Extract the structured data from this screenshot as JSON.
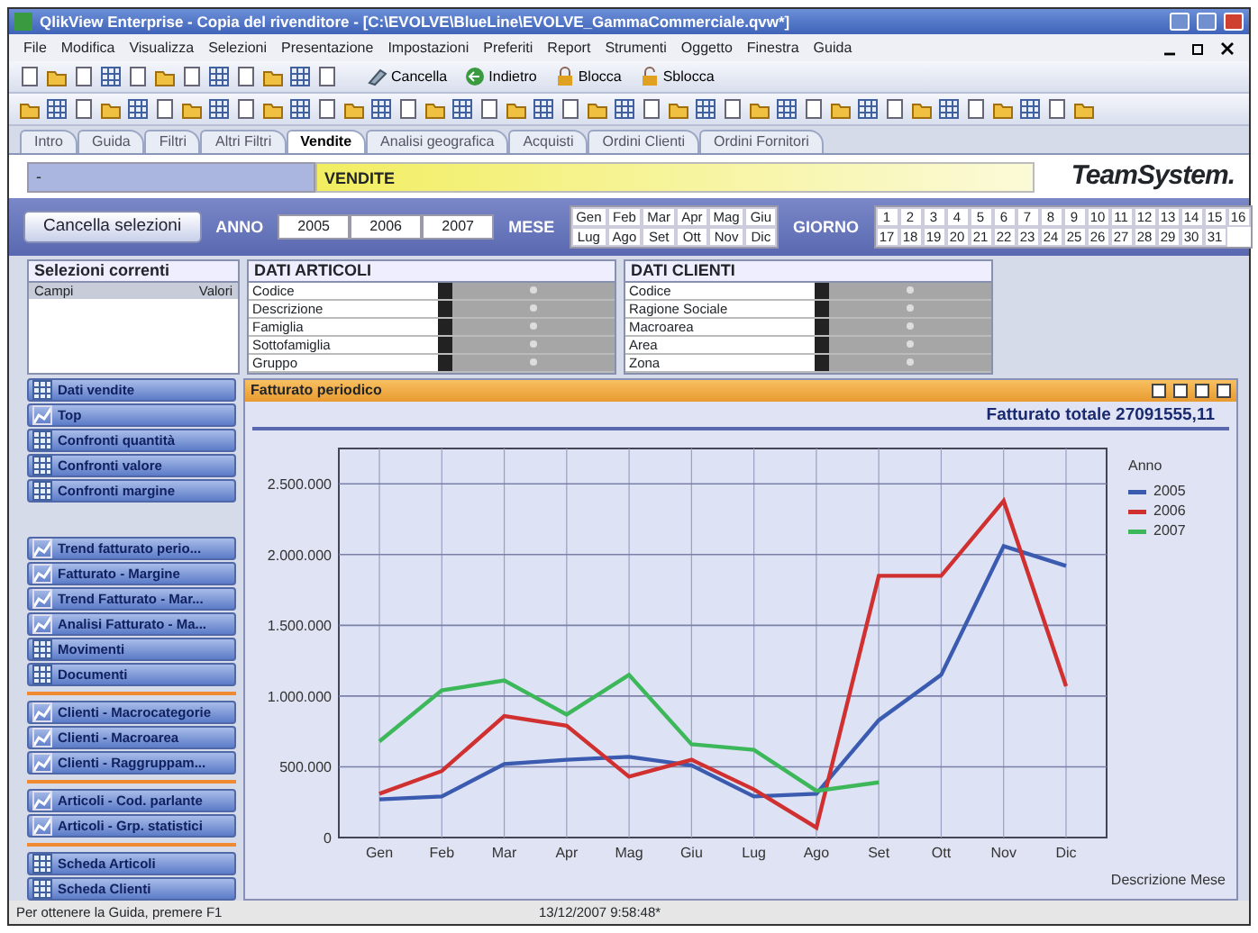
{
  "window": {
    "title": "QlikView Enterprise - Copia del rivenditore - [C:\\EVOLVE\\BlueLine\\EVOLVE_GammaCommerciale.qvw*]"
  },
  "menu": [
    "File",
    "Modifica",
    "Visualizza",
    "Selezioni",
    "Presentazione",
    "Impostazioni",
    "Preferiti",
    "Report",
    "Strumenti",
    "Oggetto",
    "Finestra",
    "Guida"
  ],
  "toolbar_buttons": [
    {
      "label": "Cancella",
      "kind": "clear"
    },
    {
      "label": "Indietro",
      "kind": "back"
    },
    {
      "label": "Blocca",
      "kind": "lock"
    },
    {
      "label": "Sblocca",
      "kind": "unlock"
    }
  ],
  "tabs": [
    {
      "label": "Intro",
      "selected": false
    },
    {
      "label": "Guida",
      "selected": false
    },
    {
      "label": "Filtri",
      "selected": false
    },
    {
      "label": "Altri Filtri",
      "selected": false
    },
    {
      "label": "Vendite",
      "selected": true
    },
    {
      "label": "Analisi geografica",
      "selected": false
    },
    {
      "label": "Acquisti",
      "selected": false
    },
    {
      "label": "Ordini Clienti",
      "selected": false
    },
    {
      "label": "Ordini Fornitori",
      "selected": false
    }
  ],
  "header": {
    "field": "-",
    "title": "VENDITE",
    "logo": "TeamSystem."
  },
  "clear_selections": "Cancella selezioni",
  "anno": {
    "label": "ANNO",
    "values": [
      "2005",
      "2006",
      "2007"
    ]
  },
  "mese": {
    "label": "MESE",
    "values": [
      "Gen",
      "Feb",
      "Mar",
      "Apr",
      "Mag",
      "Giu",
      "Lug",
      "Ago",
      "Set",
      "Ott",
      "Nov",
      "Dic"
    ]
  },
  "giorno": {
    "label": "GIORNO",
    "values": [
      "1",
      "2",
      "3",
      "4",
      "5",
      "6",
      "7",
      "8",
      "9",
      "10",
      "11",
      "12",
      "13",
      "14",
      "15",
      "16",
      "17",
      "18",
      "19",
      "20",
      "21",
      "22",
      "23",
      "24",
      "25",
      "26",
      "27",
      "28",
      "29",
      "30",
      "31"
    ]
  },
  "current_selections": {
    "title": "Selezioni correnti",
    "columns": [
      "Campi",
      "Valori"
    ]
  },
  "dati_articoli": {
    "title": "DATI ARTICOLI",
    "fields": [
      "Codice",
      "Descrizione",
      "Famiglia",
      "Sottofamiglia",
      "Gruppo"
    ]
  },
  "dati_clienti": {
    "title": "DATI CLIENTI",
    "fields": [
      "Codice",
      "Ragione Sociale",
      "Macroarea",
      "Area",
      "Zona"
    ]
  },
  "sidebar": [
    [
      {
        "label": "Dati vendite",
        "kind": "table"
      },
      {
        "label": "Top",
        "kind": "chart"
      },
      {
        "label": "Confronti quantità",
        "kind": "table"
      },
      {
        "label": "Confronti valore",
        "kind": "table"
      },
      {
        "label": "Confronti margine",
        "kind": "table"
      }
    ],
    [
      {
        "label": "Trend fatturato perio...",
        "kind": "chart"
      },
      {
        "label": "Fatturato - Margine",
        "kind": "chart"
      },
      {
        "label": "Trend Fatturato - Mar...",
        "kind": "chart"
      },
      {
        "label": "Analisi Fatturato - Ma...",
        "kind": "chart"
      },
      {
        "label": "Movimenti",
        "kind": "table"
      },
      {
        "label": "Documenti",
        "kind": "table"
      }
    ],
    [
      {
        "label": "Clienti - Macrocategorie",
        "kind": "chart"
      },
      {
        "label": "Clienti - Macroarea",
        "kind": "chart"
      },
      {
        "label": "Clienti - Raggruppam...",
        "kind": "chart"
      }
    ],
    [
      {
        "label": "Articoli - Cod. parlante",
        "kind": "chart"
      },
      {
        "label": "Articoli - Grp. statistici",
        "kind": "chart"
      }
    ],
    [
      {
        "label": "Scheda Articoli",
        "kind": "table"
      },
      {
        "label": "Scheda Clienti",
        "kind": "table"
      }
    ]
  ],
  "chart_panel": {
    "title": "Fatturato periodico",
    "total": "Fatturato totale 27091555,11",
    "legend_title": "Anno",
    "chart_data": {
      "type": "line",
      "grid": true,
      "legend": true,
      "xlabel": "Descrizione Mese",
      "categories": [
        "Gen",
        "Feb",
        "Mar",
        "Apr",
        "Mag",
        "Giu",
        "Lug",
        "Ago",
        "Set",
        "Ott",
        "Nov",
        "Dic"
      ],
      "ylim": [
        0,
        2750000
      ],
      "yticks": [
        {
          "value": 0,
          "label": "0"
        },
        {
          "value": 500000,
          "label": "500.000"
        },
        {
          "value": 1000000,
          "label": "1.000.000"
        },
        {
          "value": 1500000,
          "label": "1.500.000"
        },
        {
          "value": 2000000,
          "label": "2.000.000"
        },
        {
          "value": 2500000,
          "label": "2.500.000"
        }
      ],
      "series": [
        {
          "name": "2005",
          "color": "#3a5bb0",
          "values": [
            270000,
            290000,
            520000,
            550000,
            570000,
            510000,
            290000,
            310000,
            830000,
            1150000,
            2060000,
            1920000
          ]
        },
        {
          "name": "2006",
          "color": "#d03030",
          "values": [
            310000,
            470000,
            860000,
            790000,
            430000,
            550000,
            340000,
            70000,
            1850000,
            1850000,
            2380000,
            1070000
          ]
        },
        {
          "name": "2007",
          "color": "#3cb85a",
          "values": [
            680000,
            1040000,
            1110000,
            870000,
            1150000,
            660000,
            620000,
            330000,
            390000,
            null,
            null,
            null
          ]
        }
      ]
    }
  },
  "status_bar": {
    "left": "Per ottenere la Guida, premere F1",
    "center": "13/12/2007 9:58:48*"
  }
}
